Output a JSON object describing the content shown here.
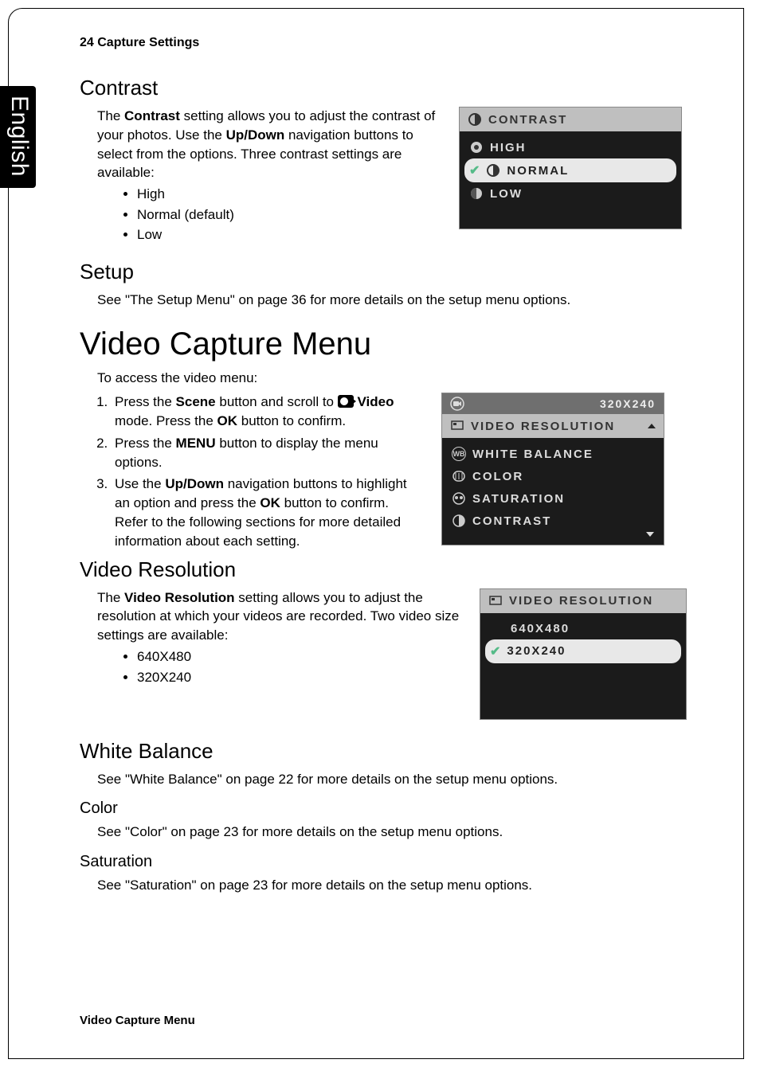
{
  "lang_tab": "English",
  "header": "24  Capture Settings",
  "contrast": {
    "title": "Contrast",
    "p1_a": "The ",
    "p1_bold": "Contrast",
    "p1_b": " setting allows you to adjust the contrast of your photos. Use the ",
    "p1_bold2": "Up/Down",
    "p1_c": " navigation buttons to select from the options. Three contrast settings are available:",
    "bullets": [
      "High",
      "Normal (default)",
      "Low"
    ],
    "screen": {
      "header": "CONTRAST",
      "items": [
        "HIGH",
        "NORMAL",
        "LOW"
      ],
      "selected": 1
    }
  },
  "setup": {
    "title": "Setup",
    "text": "See \"The Setup Menu\" on page 36 for more details on the setup menu options."
  },
  "video_menu": {
    "title": "Video Capture Menu",
    "intro": "To access the video menu:",
    "step1_a": "Press the ",
    "step1_b1": "Scene",
    "step1_c": " button and scroll to ",
    "step1_b2": "Video",
    "step1_d": " mode. Press the ",
    "step1_b3": "OK",
    "step1_e": " button to confirm.",
    "step2_a": "Press the ",
    "step2_b1": "MENU",
    "step2_c": " button to display the menu options.",
    "step3_a": "Use the ",
    "step3_b1": "Up/Down",
    "step3_c": " navigation buttons to highlight an option and press the ",
    "step3_b2": "OK",
    "step3_d": " button to confirm. Refer to the following sections for more detailed information about each setting.",
    "screen": {
      "tab_right": "320X240",
      "selected_header": "VIDEO RESOLUTION",
      "items": [
        "WHITE BALANCE",
        "COLOR",
        "SATURATION",
        "CONTRAST"
      ]
    }
  },
  "video_res": {
    "title": "Video Resolution",
    "p_a": "The ",
    "p_bold": "Video Resolution",
    "p_b": " setting allows you to adjust the resolution at which your videos are recorded. Two video size settings are available:",
    "bullets": [
      "640X480",
      "320X240"
    ],
    "screen": {
      "header": "VIDEO RESOLUTION",
      "items": [
        "640X480",
        "320X240"
      ],
      "selected": 1
    }
  },
  "wb": {
    "title": "White Balance",
    "text": "See \"White Balance\" on page 22 for more details on the setup menu options."
  },
  "color": {
    "title": "Color",
    "text": "See \"Color\" on page 23 for more details on the setup menu options."
  },
  "sat": {
    "title": "Saturation",
    "text": "See \"Saturation\" on page 23 for more details on the setup menu options."
  },
  "footer": "Video Capture Menu"
}
